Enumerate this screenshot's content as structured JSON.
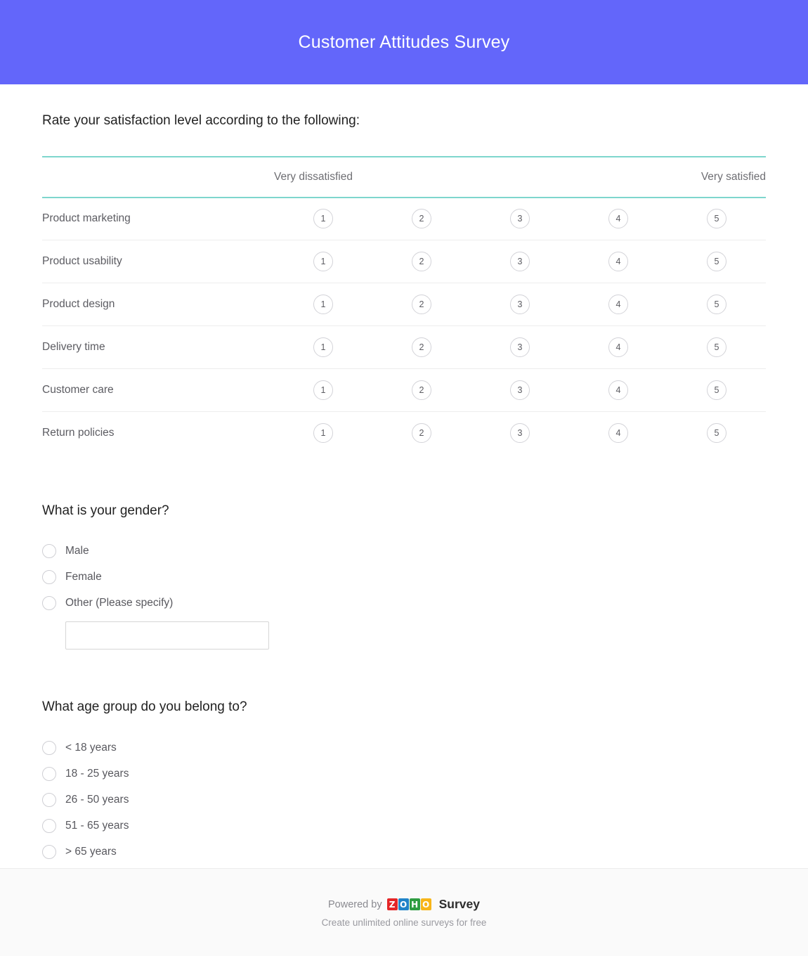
{
  "header": {
    "title": "Customer Attitudes Survey",
    "background_color": "#6366fa",
    "title_color": "#ffffff"
  },
  "matrix_question": {
    "question": "Rate your satisfaction level according to the following:",
    "scale_left_label": "Very dissatisfied",
    "scale_right_label": "Very satisfied",
    "scale_values": [
      "1",
      "2",
      "3",
      "4",
      "5"
    ],
    "rows": [
      {
        "label": "Product marketing"
      },
      {
        "label": "Product usability"
      },
      {
        "label": "Product design"
      },
      {
        "label": "Delivery time"
      },
      {
        "label": "Customer care"
      },
      {
        "label": "Return policies"
      }
    ],
    "border_color": "#7ed6cd"
  },
  "gender_question": {
    "question": "What is your gender?",
    "options": [
      {
        "label": "Male"
      },
      {
        "label": "Female"
      },
      {
        "label": "Other (Please specify)"
      }
    ],
    "other_input": {
      "value": "",
      "placeholder": ""
    }
  },
  "age_question": {
    "question": "What age group do you belong to?",
    "options": [
      {
        "label": "< 18 years"
      },
      {
        "label": "18 - 25 years"
      },
      {
        "label": "26 - 50 years"
      },
      {
        "label": "51 - 65 years"
      },
      {
        "label": "> 65 years"
      }
    ]
  },
  "footer": {
    "powered_by": "Powered by",
    "logo_letters": [
      {
        "char": "Z",
        "color": "#e42527"
      },
      {
        "char": "O",
        "color": "#2083c8"
      },
      {
        "char": "H",
        "color": "#2e9c41"
      },
      {
        "char": "O",
        "color": "#f7b519"
      }
    ],
    "brand_word": "Survey",
    "tagline": "Create unlimited online surveys for free"
  }
}
